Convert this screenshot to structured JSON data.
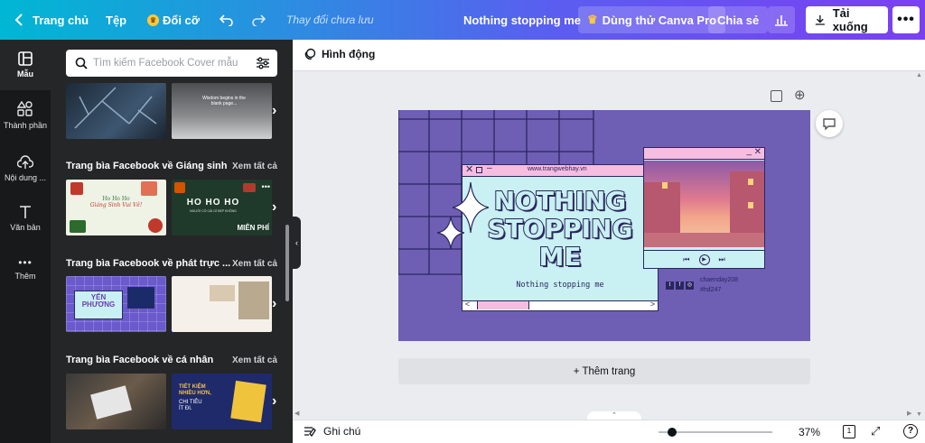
{
  "topbar": {
    "home": "Trang chủ",
    "file": "Tệp",
    "resize": "Đổi cỡ",
    "status": "Thay đổi chưa lưu",
    "doc_title": "Nothing stopping me",
    "pro": "Dùng thử Canva Pro",
    "share": "Chia sẻ",
    "download": "Tải xuống"
  },
  "rail": [
    {
      "label": "Mẫu",
      "icon": "templates-icon"
    },
    {
      "label": "Thành phần",
      "icon": "elements-icon"
    },
    {
      "label": "Nội dung ...",
      "icon": "upload-icon"
    },
    {
      "label": "Văn bản",
      "icon": "text-icon"
    },
    {
      "label": "Thêm",
      "icon": "more-icon"
    }
  ],
  "panel": {
    "search_placeholder": "Tìm kiếm Facebook Cover mẫu",
    "see_all": "Xem tất cả",
    "sections": [
      {
        "title": "Trang bìa Facebook về Giáng sinh"
      },
      {
        "title": "Trang bìa Facebook về phát trực ..."
      },
      {
        "title": "Trang bìa Facebook về cá nhân"
      }
    ],
    "thumbs": {
      "t0b": "Wisdom begins in the blank page...",
      "t1a_line1": "Ho Ho Ho",
      "t1a_line2": "Giáng Sinh Vui Vẻ!",
      "t1b": "HO HO HO",
      "t1b_sub": "NGƯỜI CÓ CÁI GÌ ĐẸP KHÔNG",
      "free": "MIỄN PHÍ",
      "t2a": "YẾN PHƯƠNG",
      "t3b_line1": "TIẾT KIỆM",
      "t3b_line2": "NHIỀU HƠN,",
      "t3b_line3": "CHI TIÊU",
      "t3b_line4": "ÍT ĐI."
    }
  },
  "canvas": {
    "animate": "Hình động",
    "add_page": "+ Thêm trang",
    "design": {
      "url": "www.trangwebhay.vn",
      "headline_1": "NOTHING",
      "headline_2": "STOPPING",
      "headline_3": "ME",
      "subtitle": "Nothing stopping me",
      "handle": "chaenday208",
      "hashtag": "#hd247"
    }
  },
  "bottombar": {
    "notes": "Ghi chú",
    "zoom_value": 37,
    "zoom": "37%",
    "page_number": "1"
  },
  "colors": {
    "accent_purple": "#6e5fb4",
    "panel_bg": "#252627",
    "rail_bg": "#18191b",
    "pink": "#f7bde0",
    "mint": "#c9f0f2"
  }
}
